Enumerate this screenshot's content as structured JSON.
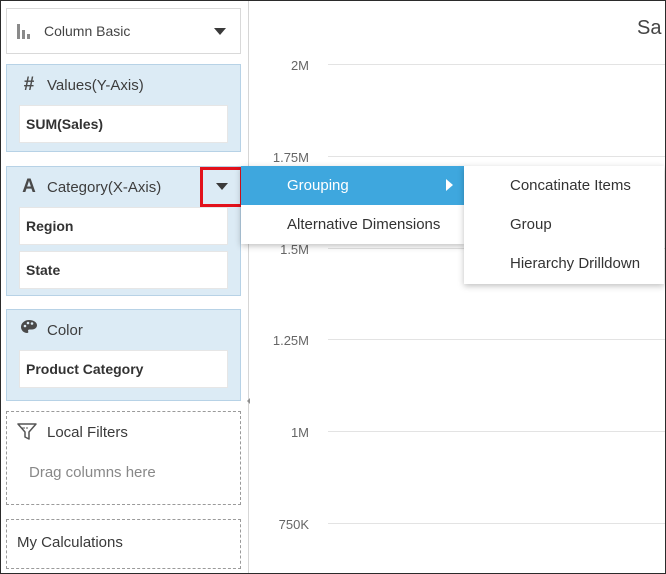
{
  "chart_type_selector": {
    "label": "Column Basic",
    "icon": "column-chart-icon"
  },
  "values_well": {
    "title": "Values(Y-Axis)",
    "icon": "hash-icon",
    "items": [
      "SUM(Sales)"
    ]
  },
  "category_well": {
    "title": "Category(X-Axis)",
    "icon": "text-a-icon",
    "items": [
      "Region",
      "State"
    ]
  },
  "color_well": {
    "title": "Color",
    "icon": "palette-icon",
    "items": [
      "Product Category"
    ]
  },
  "local_filters": {
    "title": "Local Filters",
    "icon": "filter-icon",
    "hint": "Drag columns here"
  },
  "my_calculations": {
    "title": "My Calculations"
  },
  "chart": {
    "title": "Sa",
    "y_ticks": [
      "2M",
      "1.75M",
      "1.5M",
      "1.25M",
      "1M",
      "750K"
    ]
  },
  "context_menu": {
    "items": [
      {
        "label": "Grouping",
        "active": true,
        "has_submenu": true
      },
      {
        "label": "Alternative Dimensions",
        "active": false,
        "has_submenu": false
      }
    ]
  },
  "submenu": {
    "items": [
      "Concatinate Items",
      "Group",
      "Hierarchy Drilldown"
    ]
  },
  "colors": {
    "well_bg": "#dcebf5",
    "menu_active": "#3ea7de",
    "highlight_border": "#e2111b"
  }
}
